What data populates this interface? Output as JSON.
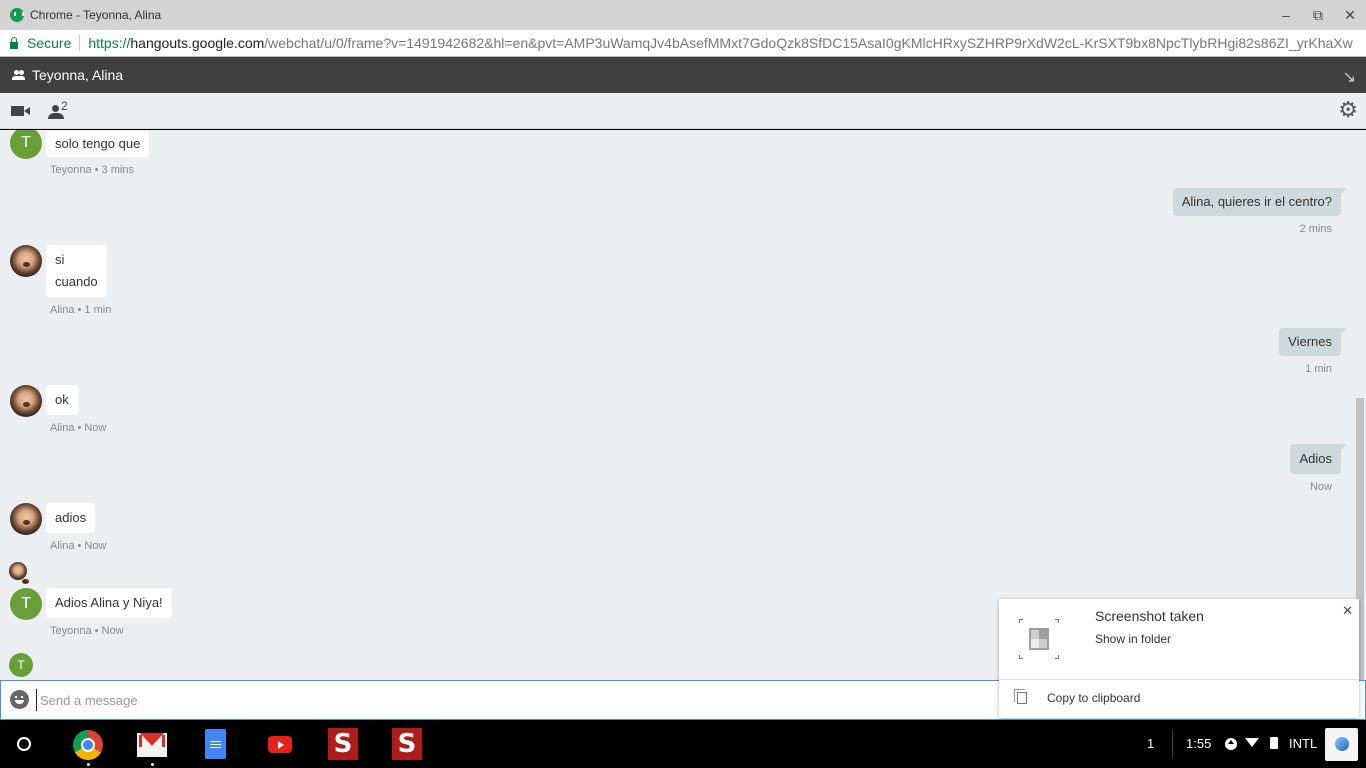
{
  "window": {
    "title": "Chrome - Teyonna, Alina",
    "controls": {
      "minimize": "‒",
      "restore": "⧉",
      "close": "✕"
    }
  },
  "addressbar": {
    "secure_label": "Secure",
    "url_scheme": "https://",
    "url_host": "hangouts.google.com",
    "url_path": "/webchat/u/0/frame?v=1491942682&hl=en&pvt=AMP3uWamqJv4bAsefMMxt7GdoQzk8SfDC15AsaI0gKMlcHRxySZHRP9rXdW2cL-KrSXT9bx8NpcTlybRHgi82s86ZI_yrKhaXw"
  },
  "hangouts": {
    "conversation_title": "Teyonna, Alina",
    "popin_icon": "↘",
    "participant_count": "2",
    "settings_icon": "⚙"
  },
  "messages": [
    {
      "direction": "in",
      "sender": "Teyonna",
      "avatar": "T",
      "lines": [
        "solo tengo que"
      ],
      "meta": "Teyonna • 3 mins"
    },
    {
      "direction": "out",
      "lines": [
        "Alina, quieres ir el centro?"
      ],
      "meta": "2 mins"
    },
    {
      "direction": "in",
      "sender": "Alina",
      "lines": [
        "si",
        "cuando"
      ],
      "meta": "Alina • 1 min"
    },
    {
      "direction": "out",
      "lines": [
        "Viernes"
      ],
      "meta": "1 min"
    },
    {
      "direction": "in",
      "sender": "Alina",
      "lines": [
        "ok"
      ],
      "meta": "Alina • Now"
    },
    {
      "direction": "out",
      "lines": [
        "Adios"
      ],
      "meta": "Now"
    },
    {
      "direction": "in",
      "sender": "Alina",
      "lines": [
        "adios"
      ],
      "meta": "Alina • Now"
    },
    {
      "direction": "in",
      "sender": "Teyonna",
      "avatar": "T",
      "lines": [
        "Adios Alina y Niya!"
      ],
      "meta": "Teyonna • Now"
    }
  ],
  "typing_avatar": "T",
  "composer": {
    "placeholder": "Send a message",
    "value": ""
  },
  "notification": {
    "title": "Screenshot taken",
    "action_show": "Show in folder",
    "action_copy": "Copy to clipboard",
    "close": "✕"
  },
  "shelf": {
    "apps": [
      "Chrome",
      "Gmail",
      "Google Docs",
      "YouTube",
      "S app",
      "S app"
    ],
    "page_indicator": "1",
    "time": "1:55",
    "ime": "INTL",
    "s_label": "S"
  }
}
